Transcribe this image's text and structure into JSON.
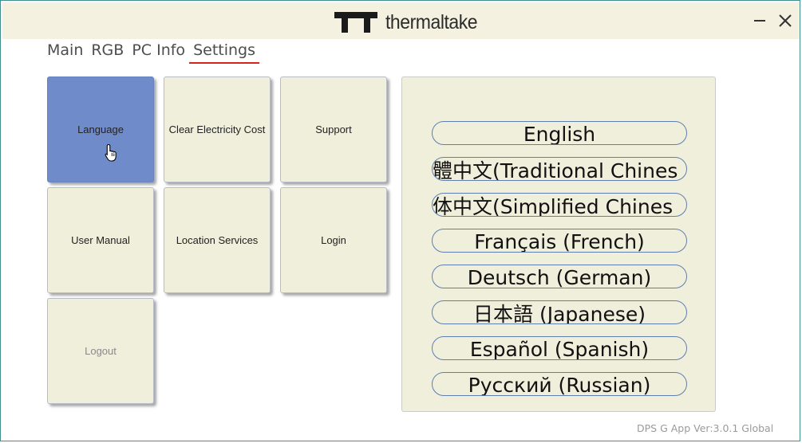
{
  "app": {
    "brand": "thermaltake",
    "version_text": "DPS G App Ver:3.0.1  Global"
  },
  "tabs": [
    "Main",
    "RGB",
    "PC Info",
    "Settings"
  ],
  "active_tab": "Settings",
  "tiles": {
    "language": "Language",
    "clear_cost": "Clear Electricity Cost",
    "support": "Support",
    "user_manual": "User Manual",
    "location": "Location Services",
    "login": "Login",
    "logout": "Logout"
  },
  "languages": [
    "English",
    "體中文(Traditional Chines",
    "体中文(Simplified Chines",
    "Français (French)",
    "Deutsch (German)",
    "日本語 (Japanese)",
    "Español (Spanish)",
    "Русский (Russian)"
  ],
  "colors": {
    "titlebar": "#f4f1e1",
    "tile_bg": "#f0efdc",
    "tile_selected": "#6f8bca",
    "tab_underline": "#d6241c",
    "lang_border": "#5f7fae"
  },
  "icons": {
    "logo": "thermaltake-tt-logo",
    "minimize": "minimize-icon",
    "close": "close-icon",
    "cursor": "hand-pointer-icon"
  }
}
